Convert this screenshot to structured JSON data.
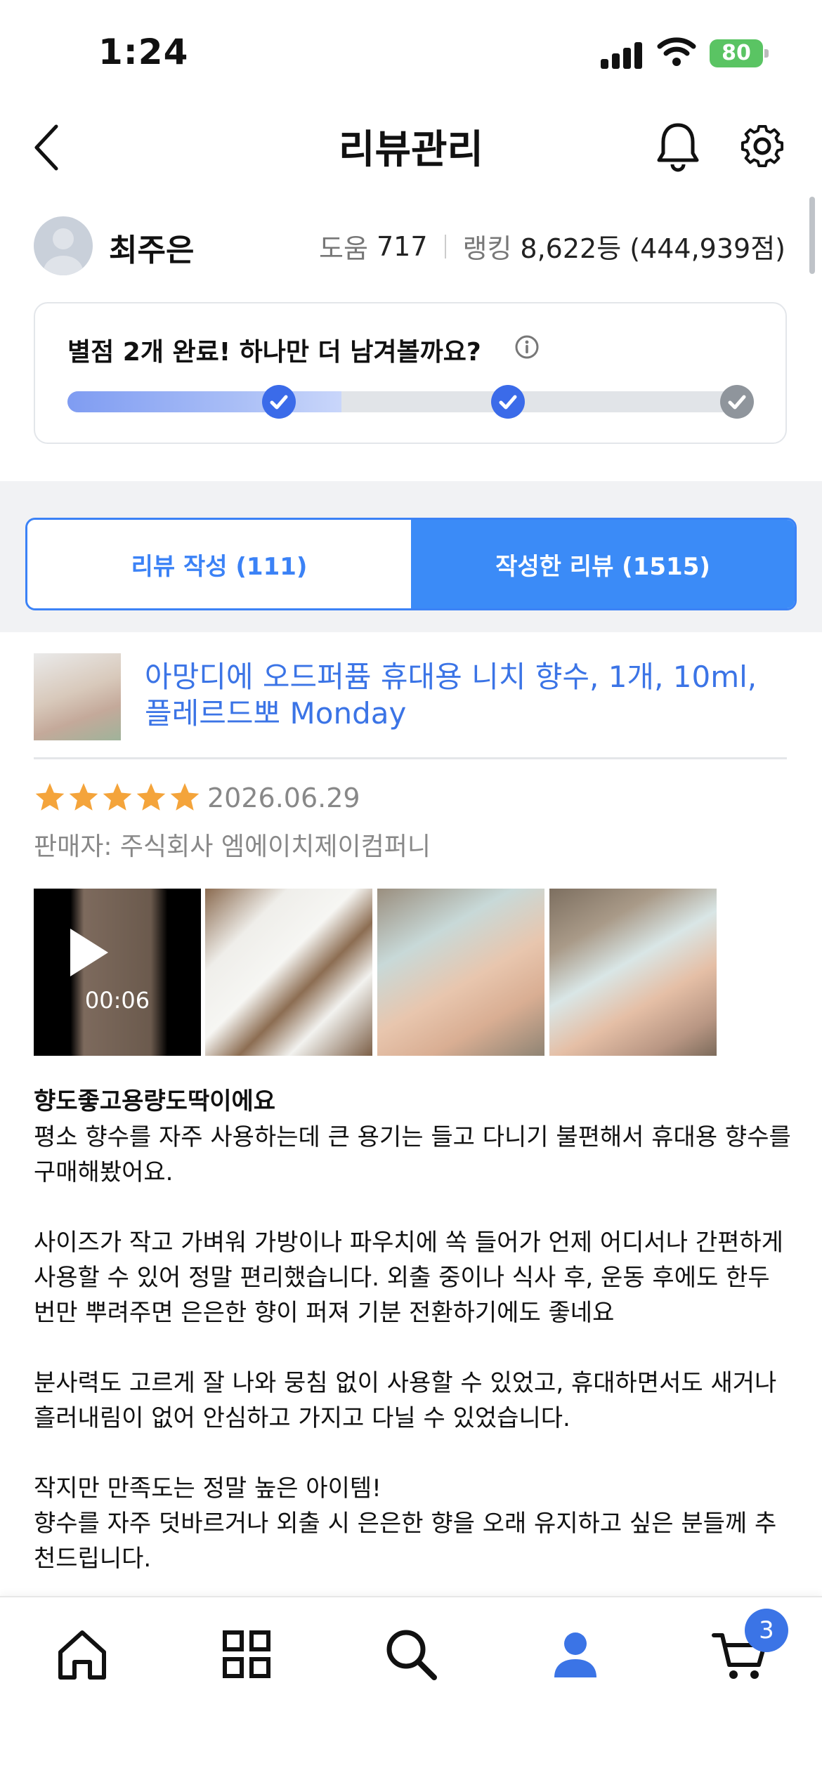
{
  "status_bar": {
    "time": "1:24",
    "battery": "80"
  },
  "header": {
    "title": "리뷰관리"
  },
  "profile": {
    "name": "최주은",
    "help_label": "도움",
    "help_value": "717",
    "ranking_label": "랭킹",
    "ranking_value": "8,622등 (444,939점)"
  },
  "progress": {
    "message": "별점 2개 완료! 하나만 더 남겨볼까요?",
    "completed_steps": 2,
    "total_steps": 3,
    "fill_fraction": 0.4
  },
  "tabs": [
    {
      "label": "리뷰 작성 (111)",
      "active": false
    },
    {
      "label": "작성한 리뷰 (1515)",
      "active": true
    }
  ],
  "review": {
    "product_name": "아망디에 오드퍼퓸 휴대용 니치 향수, 1개, 10ml, 플레르드뽀 Monday",
    "rating": 5,
    "date": "2026.06.29",
    "seller": "판매자: 주식회사 엠에이치제이컴퍼니",
    "video_duration": "00:06",
    "title": "향도좋고용량도딱이에요",
    "body": "평소 향수를 자주 사용하는데 큰 용기는 들고 다니기 불편해서 휴대용 향수를 구매해봤어요.\n\n사이즈가 작고 가벼워 가방이나 파우치에 쏙 들어가 언제 어디서나 간편하게 사용할 수 있어 정말 편리했습니다. 외출 중이나 식사 후, 운동 후에도 한두 번만 뿌려주면 은은한 향이 퍼져 기분 전환하기에도 좋네요\n\n분사력도 고르게 잘 나와 뭉침 없이 사용할 수 있었고, 휴대하면서도 새거나 흘러내림이 없어 안심하고 가지고 다닐 수 있었습니다.\n\n작지만 만족도는 정말 높은 아이템!\n향수를 자주 덧바르거나 외출 시 은은한 향을 오래 유지하고 싶은 분들께 추천드립니다."
  },
  "bottom_nav": {
    "items": [
      "home-icon",
      "grid-icon",
      "search-icon",
      "person-icon",
      "cart-icon"
    ],
    "active": "person-icon",
    "cart_count": "3"
  },
  "colors": {
    "accent": "#3b82f6",
    "star": "#f4a43b",
    "link": "#3b74e6"
  }
}
